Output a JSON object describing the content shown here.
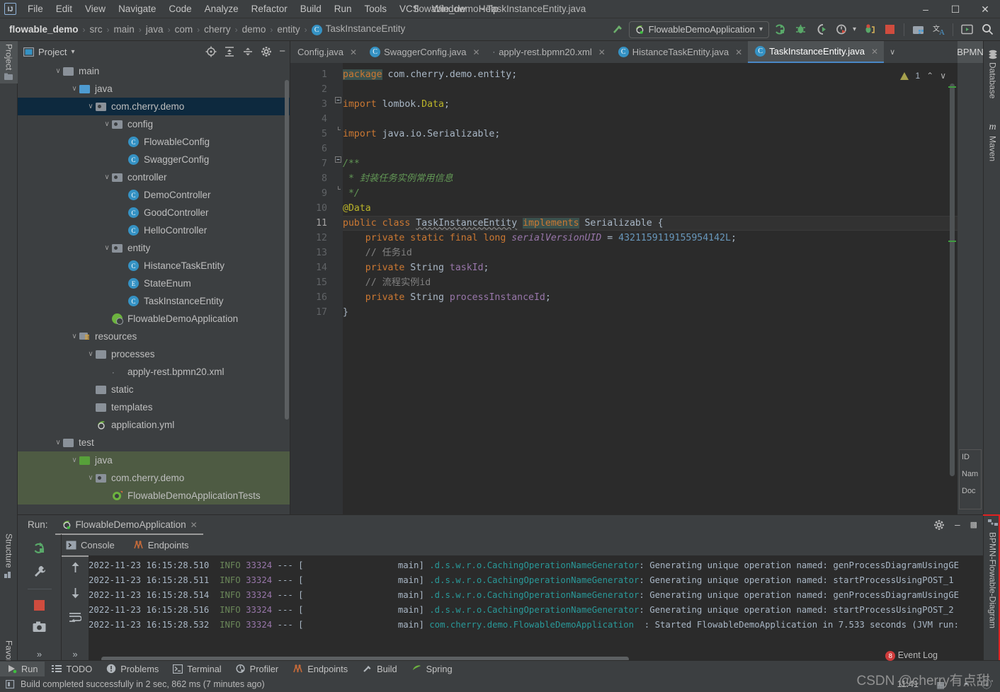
{
  "window": {
    "title": "flowable_demo - TaskInstanceEntity.java",
    "minimize": "–",
    "maximize": "☐",
    "close": "✕"
  },
  "menu": {
    "items": [
      "File",
      "Edit",
      "View",
      "Navigate",
      "Code",
      "Analyze",
      "Refactor",
      "Build",
      "Run",
      "Tools",
      "VCS",
      "Window",
      "Help"
    ]
  },
  "breadcrumb": {
    "project": "flowable_demo",
    "items": [
      "src",
      "main",
      "java",
      "com",
      "cherry",
      "demo",
      "entity"
    ],
    "file": "TaskInstanceEntity",
    "file_icon": "C",
    "separator": "›"
  },
  "toolbar": {
    "run_config": "FlowableDemoApplication",
    "dropdown_arrow": "▾",
    "icons": [
      "build-hammer-icon",
      "run-icon",
      "debug-icon",
      "run-coverage-icon",
      "profiler-icon",
      "debug-attach-icon",
      "stop-icon",
      "project-structure-icon",
      "translate-icon",
      "presentation-icon",
      "search-everywhere-icon"
    ]
  },
  "left_strip": {
    "items": [
      {
        "label": "Project",
        "icon": "project-icon",
        "selected": true
      },
      {
        "label": "Structure",
        "icon": "structure-icon",
        "selected": false
      },
      {
        "label": "Favorites",
        "icon": "star-icon",
        "selected": false
      }
    ]
  },
  "right_strip": {
    "items": [
      {
        "label": "Database",
        "icon": "database-icon"
      },
      {
        "label": "Maven",
        "icon": "maven-icon"
      }
    ]
  },
  "project_panel": {
    "title": "Project",
    "dropdown": "▾",
    "header_icons": [
      "locate-icon",
      "expand-all-icon",
      "collapse-all-icon",
      "gear-icon",
      "hide-icon"
    ],
    "tree": [
      {
        "depth": 2,
        "label": "main",
        "icon": "folder",
        "chevron": "∨",
        "state": "none"
      },
      {
        "depth": 3,
        "label": "java",
        "icon": "folder-source",
        "chevron": "∨",
        "state": "none"
      },
      {
        "depth": 4,
        "label": "com.cherry.demo",
        "icon": "package",
        "chevron": "∨",
        "state": "selected-blue"
      },
      {
        "depth": 5,
        "label": "config",
        "icon": "package",
        "chevron": "∨",
        "state": "none"
      },
      {
        "depth": 6,
        "label": "FlowableConfig",
        "icon": "class",
        "chevron": "",
        "state": "none"
      },
      {
        "depth": 6,
        "label": "SwaggerConfig",
        "icon": "class",
        "chevron": "",
        "state": "none"
      },
      {
        "depth": 5,
        "label": "controller",
        "icon": "package",
        "chevron": "∨",
        "state": "none"
      },
      {
        "depth": 6,
        "label": "DemoController",
        "icon": "class",
        "chevron": "",
        "state": "none"
      },
      {
        "depth": 6,
        "label": "GoodController",
        "icon": "class",
        "chevron": "",
        "state": "none"
      },
      {
        "depth": 6,
        "label": "HelloController",
        "icon": "class",
        "chevron": "",
        "state": "none"
      },
      {
        "depth": 5,
        "label": "entity",
        "icon": "package",
        "chevron": "∨",
        "state": "none"
      },
      {
        "depth": 6,
        "label": "HistanceTaskEntity",
        "icon": "class",
        "chevron": "",
        "state": "none"
      },
      {
        "depth": 6,
        "label": "StateEnum",
        "icon": "enum",
        "chevron": "",
        "state": "none"
      },
      {
        "depth": 6,
        "label": "TaskInstanceEntity",
        "icon": "class",
        "chevron": "",
        "state": "none"
      },
      {
        "depth": 5,
        "label": "FlowableDemoApplication",
        "icon": "spring-boot",
        "chevron": "",
        "state": "none"
      },
      {
        "depth": 3,
        "label": "resources",
        "icon": "folder-resources",
        "chevron": "∨",
        "state": "none"
      },
      {
        "depth": 4,
        "label": "processes",
        "icon": "folder",
        "chevron": "∨",
        "state": "none"
      },
      {
        "depth": 5,
        "label": "apply-rest.bpmn20.xml",
        "icon": "xml",
        "chevron": "",
        "state": "none"
      },
      {
        "depth": 4,
        "label": "static",
        "icon": "folder",
        "chevron": "",
        "state": "none"
      },
      {
        "depth": 4,
        "label": "templates",
        "icon": "folder",
        "chevron": "",
        "state": "none"
      },
      {
        "depth": 4,
        "label": "application.yml",
        "icon": "spring-yml",
        "chevron": "",
        "state": "none"
      },
      {
        "depth": 2,
        "label": "test",
        "icon": "folder",
        "chevron": "∨",
        "state": "none"
      },
      {
        "depth": 3,
        "label": "java",
        "icon": "folder-test-source",
        "chevron": "∨",
        "state": "selected-green"
      },
      {
        "depth": 4,
        "label": "com.cherry.demo",
        "icon": "package",
        "chevron": "∨",
        "state": "selected-green"
      },
      {
        "depth": 5,
        "label": "FlowableDemoApplicationTests",
        "icon": "spring-test",
        "chevron": "",
        "state": "selected-green"
      }
    ]
  },
  "editor": {
    "tabs": [
      {
        "label": "Config.java",
        "icon": "",
        "active": false,
        "close": "✕"
      },
      {
        "label": "SwaggerConfig.java",
        "icon": "C",
        "active": false,
        "close": "✕"
      },
      {
        "label": "apply-rest.bpmn20.xml",
        "icon": "xml",
        "active": false,
        "close": "✕"
      },
      {
        "label": "HistanceTaskEntity.java",
        "icon": "C",
        "active": false,
        "close": "✕"
      },
      {
        "label": "TaskInstanceEntity.java",
        "icon": "C",
        "active": true,
        "close": "✕"
      }
    ],
    "tabs_overflow": "∨",
    "bpmn_tab": "BPMN",
    "warning_count": "1",
    "prev_arrow": "⌃",
    "next_arrow": "∨",
    "line_numbers": [
      "1",
      "2",
      "3",
      "4",
      "5",
      "6",
      "7",
      "8",
      "9",
      "10",
      "11",
      "12",
      "13",
      "14",
      "15",
      "16",
      "17"
    ],
    "current_line": 11,
    "lines": [
      {
        "n": 1,
        "segments": [
          {
            "t": "package",
            "c": "kw",
            "hl": true
          },
          {
            "t": " com.cherry.demo.entity;",
            "c": "plain"
          }
        ]
      },
      {
        "n": 2,
        "segments": []
      },
      {
        "n": 3,
        "segments": [
          {
            "t": "import",
            "c": "kw"
          },
          {
            "t": " lombok.",
            "c": "plain"
          },
          {
            "t": "Data",
            "c": "ann"
          },
          {
            "t": ";",
            "c": "plain"
          }
        ],
        "fold": "minus"
      },
      {
        "n": 4,
        "segments": []
      },
      {
        "n": 5,
        "segments": [
          {
            "t": "import",
            "c": "kw"
          },
          {
            "t": " java.io.Serializable;",
            "c": "plain"
          }
        ],
        "fold": "end"
      },
      {
        "n": 6,
        "segments": []
      },
      {
        "n": 7,
        "segments": [
          {
            "t": "/**",
            "c": "cmt-i"
          }
        ],
        "fold": "minus"
      },
      {
        "n": 8,
        "segments": [
          {
            "t": " * 封装任务实例常用信息",
            "c": "cmt-i"
          }
        ]
      },
      {
        "n": 9,
        "segments": [
          {
            "t": " */",
            "c": "cmt-i"
          }
        ],
        "fold": "end"
      },
      {
        "n": 10,
        "segments": [
          {
            "t": "@Data",
            "c": "ann"
          }
        ]
      },
      {
        "n": 11,
        "segments": [
          {
            "t": "public",
            "c": "kw"
          },
          {
            "t": " ",
            "c": "plain"
          },
          {
            "t": "class",
            "c": "kw"
          },
          {
            "t": " ",
            "c": "plain"
          },
          {
            "t": "TaskInstanceEntity",
            "c": "cname-u"
          },
          {
            "t": " ",
            "c": "plain"
          },
          {
            "t": "implements",
            "c": "kw",
            "hl": true
          },
          {
            "t": " Serializable {",
            "c": "plain"
          }
        ]
      },
      {
        "n": 12,
        "segments": [
          {
            "t": "    ",
            "c": "plain"
          },
          {
            "t": "private",
            "c": "kw"
          },
          {
            "t": " ",
            "c": "plain"
          },
          {
            "t": "static",
            "c": "kw"
          },
          {
            "t": " ",
            "c": "plain"
          },
          {
            "t": "final",
            "c": "kw"
          },
          {
            "t": " ",
            "c": "plain"
          },
          {
            "t": "long",
            "c": "kw"
          },
          {
            "t": " ",
            "c": "plain"
          },
          {
            "t": "serialVersionUID",
            "c": "static-it"
          },
          {
            "t": " = ",
            "c": "plain"
          },
          {
            "t": "4321159119155954142L",
            "c": "num"
          },
          {
            "t": ";",
            "c": "plain"
          }
        ]
      },
      {
        "n": 13,
        "segments": [
          {
            "t": "    // 任务id",
            "c": "cmt"
          }
        ]
      },
      {
        "n": 14,
        "segments": [
          {
            "t": "    ",
            "c": "plain"
          },
          {
            "t": "private",
            "c": "kw"
          },
          {
            "t": " String ",
            "c": "plain"
          },
          {
            "t": "taskId",
            "c": "fld"
          },
          {
            "t": ";",
            "c": "plain"
          }
        ]
      },
      {
        "n": 15,
        "segments": [
          {
            "t": "    // 流程实例id",
            "c": "cmt"
          }
        ]
      },
      {
        "n": 16,
        "segments": [
          {
            "t": "    ",
            "c": "plain"
          },
          {
            "t": "private",
            "c": "kw"
          },
          {
            "t": " String ",
            "c": "plain"
          },
          {
            "t": "processInstanceId",
            "c": "fld"
          },
          {
            "t": ";",
            "c": "plain"
          }
        ]
      },
      {
        "n": 17,
        "segments": [
          {
            "t": "}",
            "c": "plain"
          }
        ]
      }
    ]
  },
  "properties_panel": {
    "rows": [
      "ID",
      "Nam",
      "Doc"
    ]
  },
  "bpmn_strip": {
    "label": "BPMN-Flowable-Diagram",
    "highlight_color": "#e02020"
  },
  "run_window": {
    "title": "Run:",
    "config_name": "FlowableDemoApplication",
    "close": "✕",
    "gear": "gear-icon",
    "minimize": "–",
    "subtabs": [
      {
        "label": "Console",
        "icon": "console-icon",
        "active": true
      },
      {
        "label": "Endpoints",
        "icon": "endpoints-icon",
        "active": false
      }
    ],
    "toolbar_icons": [
      "rerun-icon",
      "wrench-icon",
      "stop-icon",
      "camera-icon",
      "more-icon"
    ],
    "console_toolbar_icons": [
      "scroll-up-icon",
      "scroll-down-icon",
      "soft-wrap-icon",
      "more-icon"
    ],
    "console_lines": [
      {
        "ts": "2022-11-23 16:15:28.510",
        "level": "INFO",
        "pid": "33324",
        "dash": "--- [",
        "thread": "main]",
        "logger": ".d.s.w.r.o.CachingOperationNameGenerator",
        "msg": ": Generating unique operation named: genProcessDiagramUsingGE"
      },
      {
        "ts": "2022-11-23 16:15:28.511",
        "level": "INFO",
        "pid": "33324",
        "dash": "--- [",
        "thread": "main]",
        "logger": ".d.s.w.r.o.CachingOperationNameGenerator",
        "msg": ": Generating unique operation named: startProcessUsingPOST_1"
      },
      {
        "ts": "2022-11-23 16:15:28.514",
        "level": "INFO",
        "pid": "33324",
        "dash": "--- [",
        "thread": "main]",
        "logger": ".d.s.w.r.o.CachingOperationNameGenerator",
        "msg": ": Generating unique operation named: genProcessDiagramUsingGE"
      },
      {
        "ts": "2022-11-23 16:15:28.516",
        "level": "INFO",
        "pid": "33324",
        "dash": "--- [",
        "thread": "main]",
        "logger": ".d.s.w.r.o.CachingOperationNameGenerator",
        "msg": ": Generating unique operation named: startProcessUsingPOST_2"
      },
      {
        "ts": "2022-11-23 16:15:28.532",
        "level": "INFO",
        "pid": "33324",
        "dash": "--- [",
        "thread": "main]",
        "logger": "com.cherry.demo.FlowableDemoApplication",
        "msg": "  : Started FlowableDemoApplication in 7.533 seconds (JVM run:"
      }
    ]
  },
  "bottom_bar": {
    "items": [
      {
        "label": "Run",
        "icon": "run-icon",
        "active": true
      },
      {
        "label": "TODO",
        "icon": "todo-icon",
        "active": false
      },
      {
        "label": "Problems",
        "icon": "problems-icon",
        "active": false
      },
      {
        "label": "Terminal",
        "icon": "terminal-icon",
        "active": false
      },
      {
        "label": "Profiler",
        "icon": "profiler-icon",
        "active": false
      },
      {
        "label": "Endpoints",
        "icon": "endpoints-icon",
        "active": false
      },
      {
        "label": "Build",
        "icon": "build-icon",
        "active": false
      },
      {
        "label": "Spring",
        "icon": "spring-icon",
        "active": false
      }
    ],
    "event_log": "Event Log",
    "event_log_badge": "8"
  },
  "status_bar": {
    "message": "Build completed successfully in 2 sec, 862 ms (7 minutes ago)",
    "time": "11:41"
  },
  "watermark": {
    "text": "CSDN @cherry有点甜·"
  }
}
